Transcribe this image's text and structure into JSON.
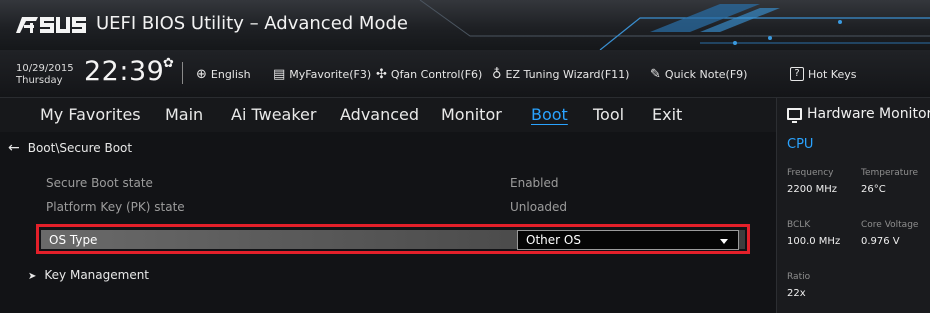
{
  "title_bar": {
    "logo_text": "ASUS",
    "title": "UEFI BIOS Utility – Advanced Mode"
  },
  "info_bar": {
    "date": "10/29/2015",
    "weekday": "Thursday",
    "time": "22:39",
    "shortcuts": [
      {
        "icon": "globe-icon",
        "label": "English"
      },
      {
        "icon": "favorites-icon",
        "label": "MyFavorite(F3)"
      },
      {
        "icon": "fan-icon",
        "label": "Qfan Control(F6)"
      },
      {
        "icon": "bulb-icon",
        "label": "EZ Tuning Wizard(F11)"
      },
      {
        "icon": "note-icon",
        "label": "Quick Note(F9)"
      },
      {
        "icon": "help-icon",
        "label": "Hot Keys"
      }
    ]
  },
  "menu": {
    "tabs": [
      "My Favorites",
      "Main",
      "Ai Tweaker",
      "Advanced",
      "Monitor",
      "Boot",
      "Tool",
      "Exit"
    ],
    "active": "Boot"
  },
  "main": {
    "breadcrumb": "Boot\\Secure Boot",
    "rows": [
      {
        "label": "Secure Boot state",
        "value": "Enabled"
      },
      {
        "label": "Platform Key (PK) state",
        "value": "Unloaded"
      }
    ],
    "os_type": {
      "label": "OS Type",
      "value": "Other OS"
    },
    "submenu": "Key Management"
  },
  "hardware_monitor": {
    "title": "Hardware Monitor",
    "section": "CPU",
    "items": [
      {
        "label": "Frequency",
        "value": "2200 MHz"
      },
      {
        "label": "Temperature",
        "value": "26°C"
      },
      {
        "label": "BCLK",
        "value": "100.0 MHz"
      },
      {
        "label": "Core Voltage",
        "value": "0.976 V"
      },
      {
        "label": "Ratio",
        "value": "22x"
      }
    ]
  },
  "colors": {
    "accent": "#2aa3ff",
    "highlight_border": "#e4202a",
    "background": "#121316"
  }
}
